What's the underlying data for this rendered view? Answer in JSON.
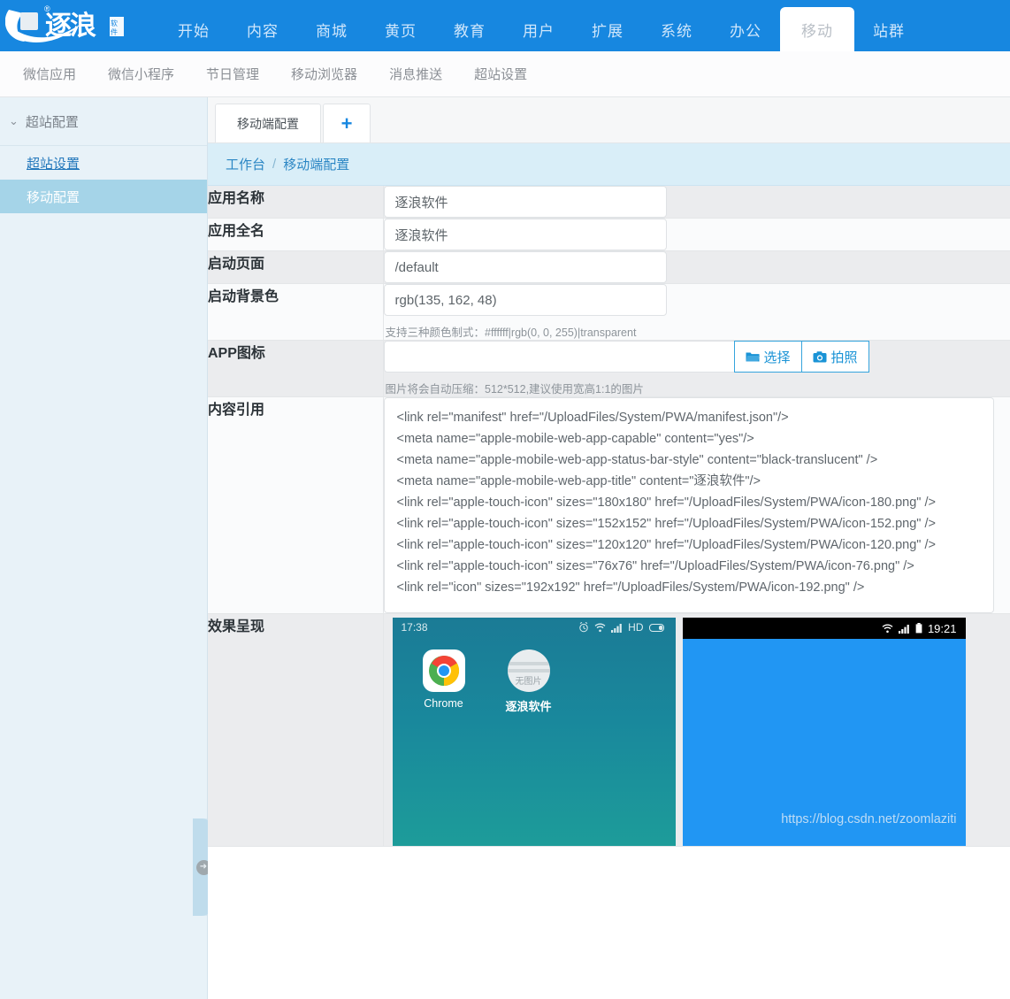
{
  "brand": {
    "name": "逐浪",
    "mark": "®",
    "sub": "软件"
  },
  "topnav": {
    "items": [
      {
        "label": "开始",
        "active": false
      },
      {
        "label": "内容",
        "active": false
      },
      {
        "label": "商城",
        "active": false
      },
      {
        "label": "黄页",
        "active": false
      },
      {
        "label": "教育",
        "active": false
      },
      {
        "label": "用户",
        "active": false
      },
      {
        "label": "扩展",
        "active": false
      },
      {
        "label": "系统",
        "active": false
      },
      {
        "label": "办公",
        "active": false
      },
      {
        "label": "移动",
        "active": true
      },
      {
        "label": "站群",
        "active": false
      }
    ]
  },
  "subnav": {
    "items": [
      {
        "label": "微信应用"
      },
      {
        "label": "微信小程序"
      },
      {
        "label": "节日管理"
      },
      {
        "label": "移动浏览器"
      },
      {
        "label": "消息推送"
      },
      {
        "label": "超站设置"
      }
    ]
  },
  "sidebar": {
    "group_label": "超站配置",
    "chevron": "⌄",
    "items": [
      {
        "label": "超站设置",
        "active": false
      },
      {
        "label": "移动配置",
        "active": true
      }
    ],
    "collapse_icon": "➜"
  },
  "tabstrip": {
    "tabs": [
      {
        "label": "移动端配置"
      }
    ],
    "add_label": "+"
  },
  "breadcrumb": {
    "root": "工作台",
    "sep": "/",
    "current": "移动端配置"
  },
  "form": {
    "rows": [
      {
        "label": "应用名称",
        "value": "逐浪软件",
        "hint": ""
      },
      {
        "label": "应用全名",
        "value": "逐浪软件",
        "hint": ""
      },
      {
        "label": "启动页面",
        "value": "/default",
        "hint": ""
      },
      {
        "label": "启动背景色",
        "value": "rgb(135, 162, 48)",
        "hint": "支持三种颜色制式：#ffffff|rgb(0, 0, 255)|transparent"
      }
    ],
    "app_icon": {
      "label": "APP图标",
      "value": "",
      "hint": "图片将会自动压缩：512*512,建议使用宽高1:1的图片",
      "choose_label": "选择",
      "choose_icon": "folder-open-icon",
      "photo_label": "拍照",
      "photo_icon": "camera-icon"
    },
    "content_ref": {
      "label": "内容引用",
      "lines": [
        "<link rel=\"manifest\" href=\"/UploadFiles/System/PWA/manifest.json\"/>",
        "<meta name=\"apple-mobile-web-app-capable\" content=\"yes\"/>",
        "<meta name=\"apple-mobile-web-app-status-bar-style\" content=\"black-translucent\" />",
        "<meta name=\"apple-mobile-web-app-title\" content=\"逐浪软件\"/>",
        "<link rel=\"apple-touch-icon\" sizes=\"180x180\" href=\"/UploadFiles/System/PWA/icon-180.png\" />",
        "<link rel=\"apple-touch-icon\" sizes=\"152x152\" href=\"/UploadFiles/System/PWA/icon-152.png\" />",
        "<link rel=\"apple-touch-icon\" sizes=\"120x120\" href=\"/UploadFiles/System/PWA/icon-120.png\" />",
        "<link rel=\"apple-touch-icon\" sizes=\"76x76\" href=\"/UploadFiles/System/PWA/icon-76.png\" />",
        "<link rel=\"icon\" sizes=\"192x192\" href=\"/UploadFiles/System/PWA/icon-192.png\" />"
      ]
    },
    "preview": {
      "label": "效果呈现",
      "phone1": {
        "time": "17:38",
        "status_icons": [
          "alarm-icon",
          "wifi-icon",
          "signal-icon",
          "battery-icon"
        ],
        "network_label": "HD",
        "apps": [
          {
            "name": "Chrome",
            "icon": "chrome-icon"
          },
          {
            "name": "逐浪软件",
            "icon": "no-image-icon",
            "icon_text": "无图片"
          }
        ]
      },
      "phone2": {
        "time": "19:21",
        "status_icons": [
          "wifi-icon",
          "signal-icon",
          "battery-icon"
        ],
        "watermark": "https://blog.csdn.net/zoomlaziti"
      }
    }
  },
  "colors": {
    "brand_blue": "#1787e0",
    "accent_blue": "#1a93d6",
    "active_side": "#a5d4e8",
    "splash_blue": "#2196f3"
  }
}
